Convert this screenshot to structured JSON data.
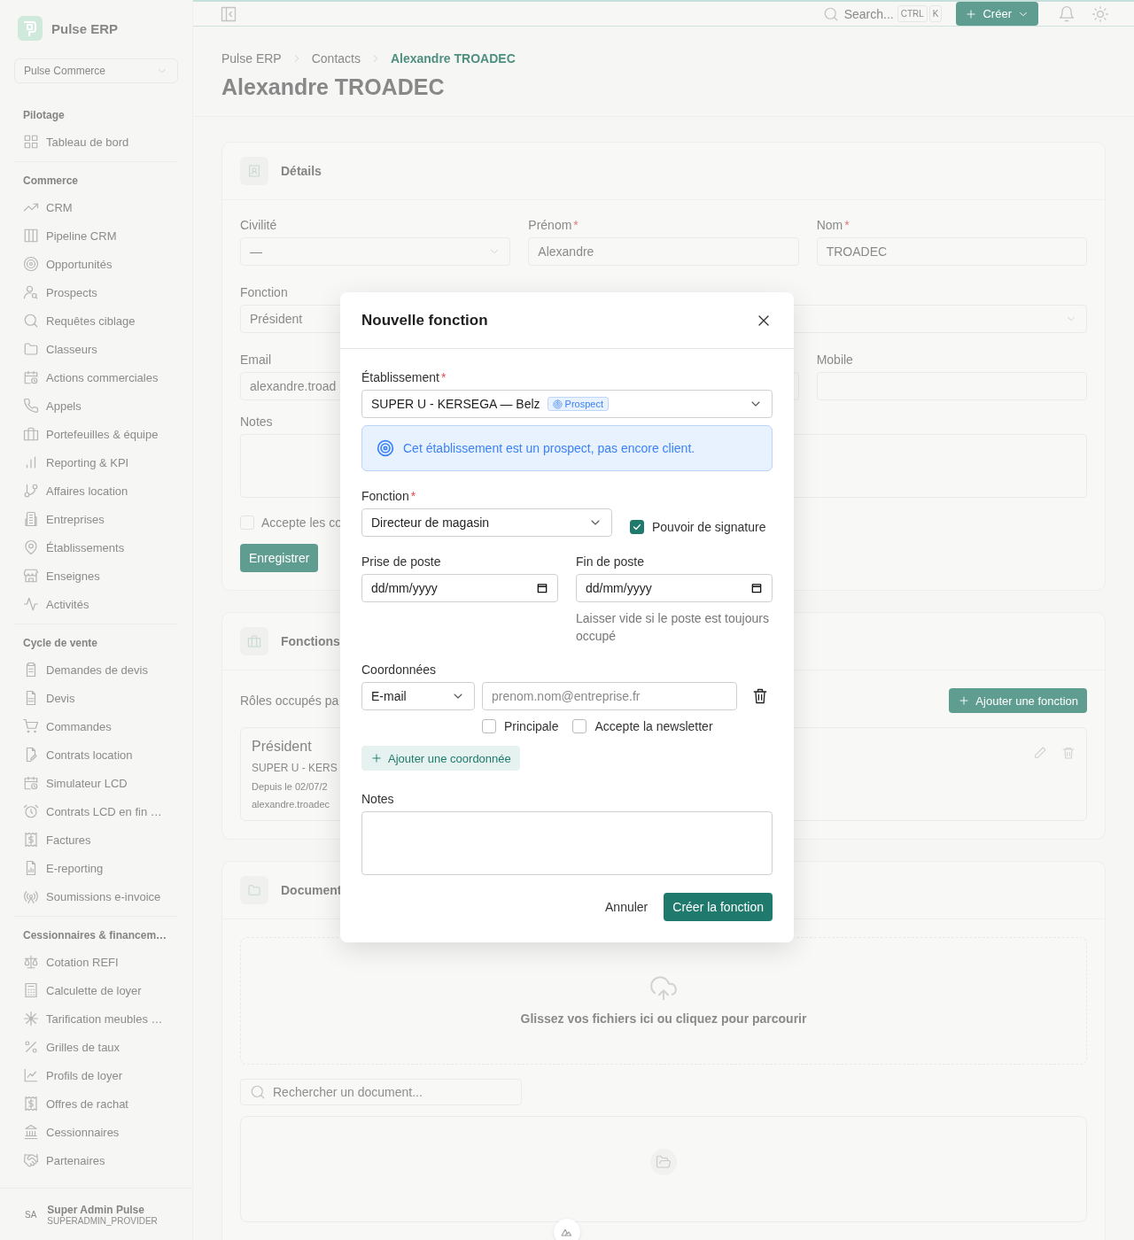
{
  "required_mark": "*",
  "sidebar": {
    "app_name": "Pulse ERP",
    "workspace": "Pulse Commerce",
    "sections": [
      {
        "title": "Pilotage",
        "items": [
          {
            "label": "Tableau de bord"
          }
        ]
      },
      {
        "title": "Commerce",
        "items": [
          {
            "label": "CRM"
          },
          {
            "label": "Pipeline CRM"
          },
          {
            "label": "Opportunités"
          },
          {
            "label": "Prospects"
          },
          {
            "label": "Requêtes ciblage"
          },
          {
            "label": "Classeurs"
          },
          {
            "label": "Actions commerciales"
          },
          {
            "label": "Appels"
          },
          {
            "label": "Portefeuilles & équipe"
          },
          {
            "label": "Reporting & KPI"
          },
          {
            "label": "Affaires location"
          },
          {
            "label": "Entreprises"
          },
          {
            "label": "Établissements"
          },
          {
            "label": "Enseignes"
          },
          {
            "label": "Activités"
          }
        ]
      },
      {
        "title": "Cycle de vente",
        "items": [
          {
            "label": "Demandes de devis"
          },
          {
            "label": "Devis"
          },
          {
            "label": "Commandes"
          },
          {
            "label": "Contrats location"
          },
          {
            "label": "Simulateur LCD"
          },
          {
            "label": "Contrats LCD en fin …"
          },
          {
            "label": "Factures"
          },
          {
            "label": "E-reporting"
          },
          {
            "label": "Soumissions e-invoice"
          }
        ]
      },
      {
        "title": "Cessionnaires & financem…",
        "items": [
          {
            "label": "Cotation REFI"
          },
          {
            "label": "Calculette de loyer"
          },
          {
            "label": "Tarification meubles …"
          },
          {
            "label": "Grilles de taux"
          },
          {
            "label": "Profils de loyer"
          },
          {
            "label": "Offres de rachat"
          },
          {
            "label": "Cessionnaires"
          },
          {
            "label": "Partenaires"
          }
        ]
      }
    ],
    "user": {
      "initials": "SA",
      "name": "Super Admin Pulse",
      "role": "SUPERADMIN_PROVIDER"
    }
  },
  "topbar": {
    "search": "Search...",
    "keys": [
      "CTRL",
      "K"
    ],
    "create": "Créer"
  },
  "breadcrumb": [
    {
      "label": "Pulse ERP",
      "selected": false
    },
    {
      "label": "Contacts",
      "selected": false
    },
    {
      "label": "Alexandre TROADEC",
      "selected": true
    }
  ],
  "page_title": "Alexandre TROADEC",
  "details": {
    "title": "Détails",
    "fields": [
      {
        "label": "Civilité",
        "kind": "select",
        "value": "—"
      },
      {
        "label": "Prénom",
        "kind": "input",
        "required": true,
        "value": "Alexandre"
      },
      {
        "label": "Nom",
        "kind": "input",
        "required": true,
        "value": "TROADEC"
      },
      {
        "label": "Fonction",
        "kind": "input",
        "value": "Président"
      },
      {
        "kind": "select",
        "wide": true
      },
      {
        "label": "Email",
        "kind": "input",
        "value": "alexandre.troad"
      },
      {
        "kind": "input"
      },
      {
        "label": "Mobile",
        "kind": "input"
      }
    ],
    "notes_label": "Notes",
    "consent": {
      "label": "Accepte les co",
      "checked": false
    },
    "save": "Enregistrer"
  },
  "functions": {
    "title": "Fonctions",
    "intro": "Rôles occupés pa",
    "add": "Ajouter une fonction",
    "role": {
      "title": "Président",
      "place": "SUPER U - KERS",
      "since": "Depuis le 02/07/2",
      "email": "alexandre.troadec"
    }
  },
  "documents": {
    "title": "Document",
    "drop": "Glissez vos fichiers ici ou cliquez pour parcourir",
    "search": "Rechercher un document..."
  },
  "modal": {
    "title": "Nouvelle fonction",
    "establishment": {
      "label": "Établissement",
      "required": true,
      "value": "SUPER U - KERSEGA — Belz",
      "badge": "Prospect"
    },
    "notice": "Cet établissement est un prospect, pas encore client.",
    "function": {
      "label": "Fonction",
      "required": true,
      "value": "Directeur de magasin"
    },
    "signature": {
      "label": "Pouvoir de signature",
      "checked": true
    },
    "start": {
      "label": "Prise de poste",
      "value": "dd/mm/yyyy"
    },
    "end": {
      "label": "Fin de poste",
      "value": "dd/mm/yyyy",
      "hint": "Laisser vide si le poste est toujours occupé"
    },
    "contacts": {
      "label": "Coordonnées",
      "type": "E-mail",
      "placeholder": "prenom.nom@entreprise.fr",
      "options": [
        {
          "label": "Principale",
          "checked": false
        },
        {
          "label": "Accepte la newsletter",
          "checked": false
        }
      ],
      "add": "Ajouter une coordonnée"
    },
    "notes": {
      "label": "Notes"
    },
    "cancel": "Annuler",
    "submit": "Créer la fonction"
  }
}
